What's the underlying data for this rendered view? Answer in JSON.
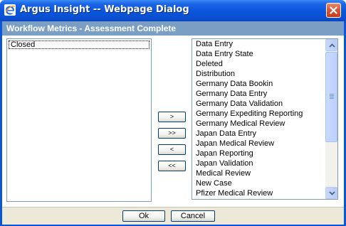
{
  "window": {
    "title": "Argus Insight -- Webpage Dialog",
    "icon": "ie-icon",
    "close_icon": "close-icon"
  },
  "header": {
    "title": "Workflow Metrics - Assessment Complete"
  },
  "selected_list": {
    "items": [
      "Closed"
    ]
  },
  "move_buttons": {
    "add": ">",
    "add_all": ">>",
    "remove": "<",
    "remove_all": "<<"
  },
  "available_list": {
    "items": [
      "Data Entry",
      "Data Entry State",
      "Deleted",
      "Distribution",
      "Germany Data Bookin",
      "Germany Data Entry",
      "Germany Data Validation",
      "Germany Expediting Reporting",
      "Germany Medical Review",
      "Japan Data Entry",
      "Japan Medical Review",
      "Japan Reporting",
      "Japan Validation",
      "Medical Review",
      "New Case",
      "Pfizer Medical Review"
    ]
  },
  "footer": {
    "ok_label": "Ok",
    "cancel_label": "Cancel"
  },
  "colors": {
    "titlebar": "#0a55dc",
    "header_band": "#7b9ec4",
    "dialog_face": "#ece9d8",
    "close_button": "#d6583a"
  }
}
